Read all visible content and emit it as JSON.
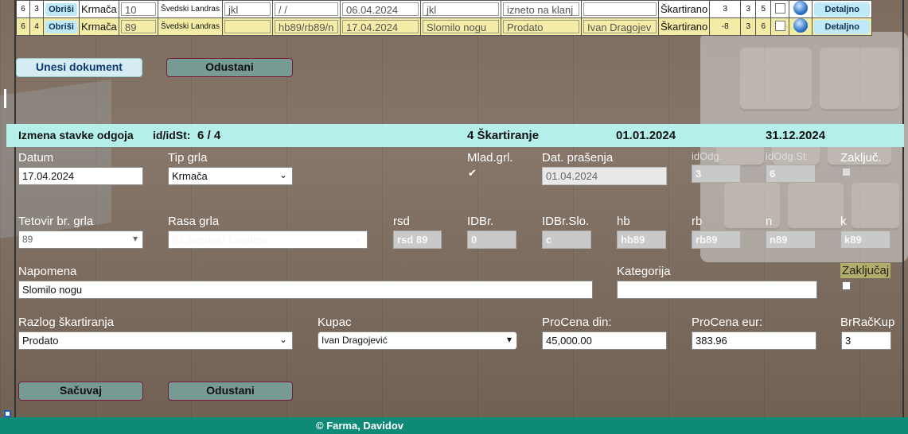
{
  "table": {
    "rows": [
      {
        "n1": "6",
        "n2": "3",
        "del": "Obriši",
        "tip": "Krmača",
        "tet": "10",
        "rasa": "Švedski Landras",
        "c1": "jkl",
        "c2": "/ /",
        "date": "06.04.2024",
        "c3": "jkl",
        "c4": "izneto na klanj",
        "c5": "",
        "status": "Škartirano",
        "v1": "3",
        "v2": "3",
        "v3": "5",
        "det": "Detaljno"
      },
      {
        "n1": "6",
        "n2": "4",
        "del": "Obriši",
        "tip": "Krmača",
        "tet": "89",
        "rasa": "Švedski Landras",
        "c1": "",
        "c2": "hb89/rb89/n",
        "date": "17.04.2024",
        "c3": "Slomilo nogu",
        "c4": "Prodato",
        "c5": "Ivan Dragojev",
        "status": "Škartirano",
        "v1": "-8",
        "v2": "3",
        "v3": "6",
        "det": "Detaljno"
      }
    ]
  },
  "buttons": {
    "unesi": "Unesi dokument",
    "odustani_top": "Odustani",
    "sacuvaj": "Sačuvaj",
    "odustani_bottom": "Odustani"
  },
  "band": {
    "title": "Izmena stavke  odgoja",
    "id_label": "id/idSt:",
    "id_value": "6 / 4",
    "type": "4 Škartiranje",
    "date_from": "01.01.2024",
    "date_to": "31.12.2024"
  },
  "form": {
    "datum": {
      "label": "Datum",
      "value": "17.04.2024"
    },
    "tip_grla": {
      "label": "Tip grla",
      "value": "Krmača"
    },
    "mlad": {
      "label": "Mlad.grl."
    },
    "dat_prasenja": {
      "label": "Dat. prašenja",
      "value": "01.04.2024"
    },
    "idodg": {
      "label": "idOdg.",
      "value": "3"
    },
    "idodgst": {
      "label": "idOdg.St",
      "value": "6"
    },
    "zakljuc": {
      "label": "Zaključ."
    },
    "tetovir": {
      "label": "Tetovir br. grla",
      "value": "89"
    },
    "rasa": {
      "label": "Rasa grla",
      "value": "03 Švedski Landras"
    },
    "rsd": {
      "label": "rsd",
      "value": "rsd 89"
    },
    "idbr": {
      "label": "IDBr.",
      "value": "0"
    },
    "idbrslo": {
      "label": "IDBr.Slo.",
      "value": "c"
    },
    "hb": {
      "label": "hb",
      "value": "hb89"
    },
    "rb": {
      "label": "rb",
      "value": "rb89"
    },
    "n": {
      "label": "n",
      "value": "n89"
    },
    "k": {
      "label": "k",
      "value": "k89"
    },
    "napomena": {
      "label": "Napomena",
      "value": "Slomilo nogu"
    },
    "kategorija": {
      "label": "Kategorija",
      "value": ""
    },
    "zakljucaj": {
      "label": "Zaključaj"
    },
    "razlog": {
      "label": "Razlog škartiranja",
      "value": "Prodato"
    },
    "kupac": {
      "label": "Kupac",
      "value": "Ivan Dragojević"
    },
    "procena_din": {
      "label": "ProCena din:",
      "value": "45,000.00"
    },
    "procena_eur": {
      "label": "ProCena eur:",
      "value": "383.96"
    },
    "brracKup": {
      "label": "BrRačKup",
      "value": "3"
    }
  },
  "footer": {
    "text": "© Farma, Davidov"
  },
  "colors": {
    "band": "#b4f0e9",
    "footer": "#0f8a78",
    "row_highlight": "#f2eba5"
  }
}
